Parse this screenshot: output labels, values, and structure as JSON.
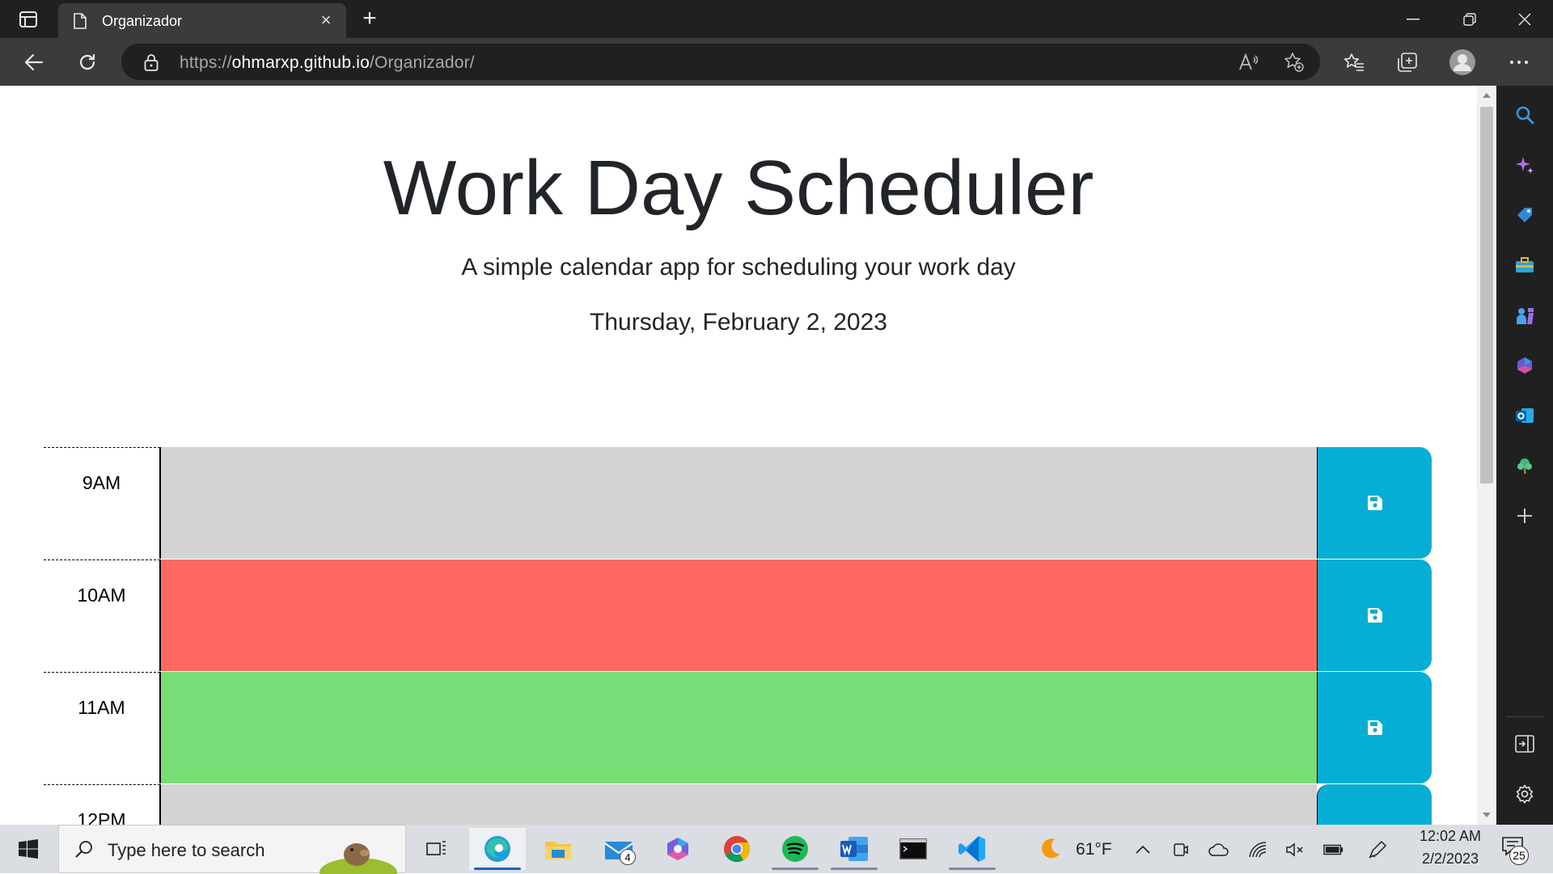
{
  "browser": {
    "tab_title": "Organizador",
    "url_prefix": "https://",
    "url_host": "ohmarxp.github.io",
    "url_path": "/Organizador/"
  },
  "page": {
    "title": "Work Day Scheduler",
    "subtitle": "A simple calendar app for scheduling your work day",
    "current_day": "Thursday, February 2, 2023"
  },
  "schedule": [
    {
      "hour": "9AM",
      "state": "past",
      "text": ""
    },
    {
      "hour": "10AM",
      "state": "present",
      "text": ""
    },
    {
      "hour": "11AM",
      "state": "future",
      "text": ""
    },
    {
      "hour": "12PM",
      "state": "past",
      "text": ""
    }
  ],
  "colors": {
    "past": "#d3d3d3",
    "present": "#ff6961",
    "future": "#77dd77",
    "save": "#06aed5"
  },
  "taskbar": {
    "search_placeholder": "Type here to search",
    "mail_badge": "4",
    "weather_temp": "61°F",
    "time": "12:02 AM",
    "date": "2/2/2023",
    "notification_count": "25"
  }
}
